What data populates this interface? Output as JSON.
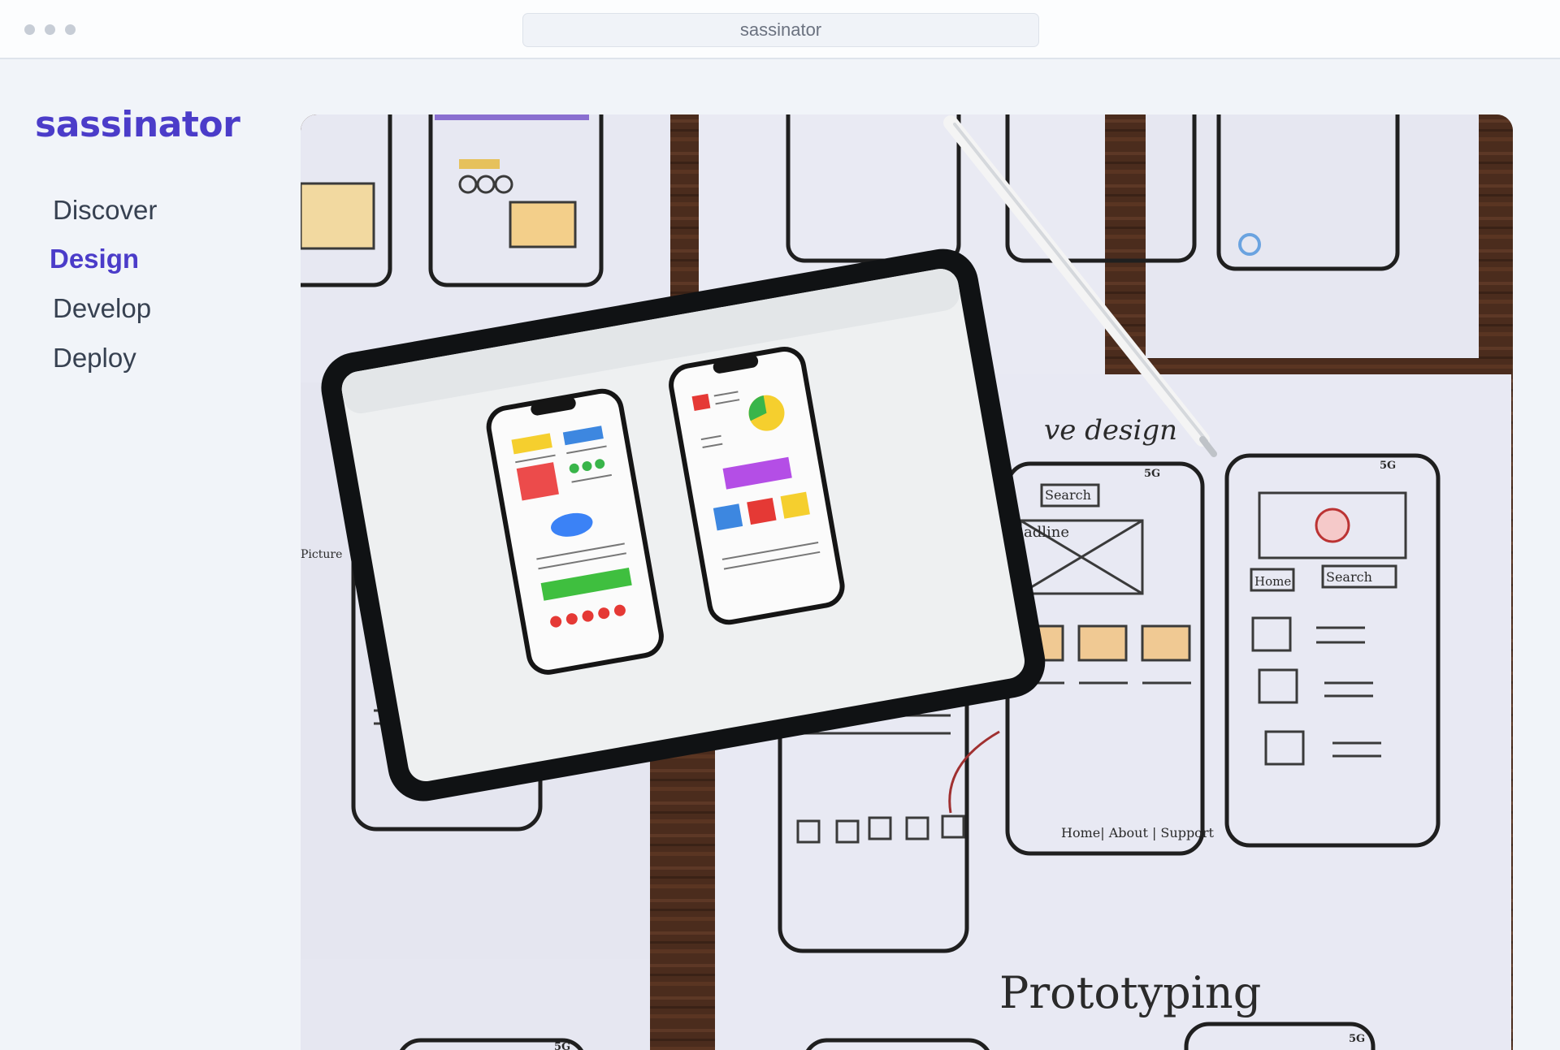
{
  "browser": {
    "url": "sassinator"
  },
  "brand": {
    "name": "sassinator",
    "color": "#4b3cc9"
  },
  "nav": {
    "items": [
      {
        "label": "Discover",
        "active": false
      },
      {
        "label": "Design",
        "active": true
      },
      {
        "label": "Develop",
        "active": false
      },
      {
        "label": "Deploy",
        "active": false
      }
    ]
  },
  "hero": {
    "texts": {
      "heading": "ve design",
      "prototyping": "Prototyping",
      "search_1": "Search",
      "search_2": "Search",
      "home": "Home",
      "headline": "adline",
      "footer_links": "Home| About | Support",
      "picture": "Picture",
      "signal_1": "5G",
      "signal_2": "5G",
      "signal_3": "5G",
      "signal_4": "5G"
    }
  }
}
